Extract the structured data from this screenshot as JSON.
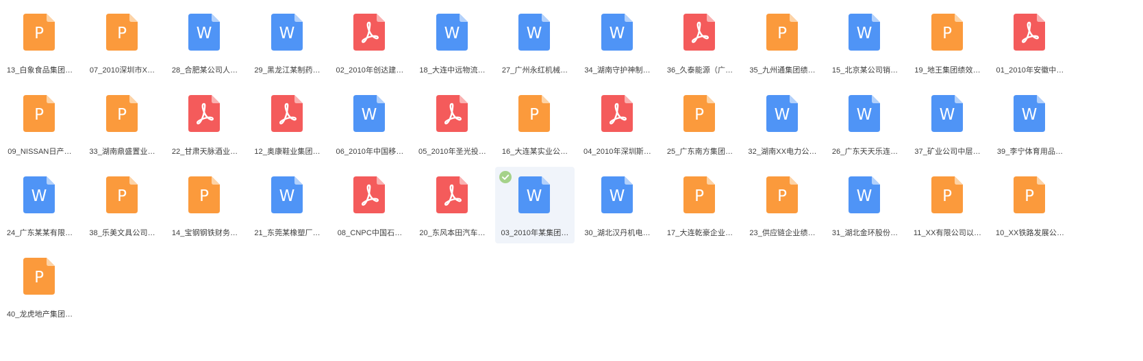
{
  "colors": {
    "ppt": "#fb9a3c",
    "ppt_fold": "#fdd3a6",
    "word": "#4f94f6",
    "word_fold": "#b3d1fb",
    "pdf": "#f45b5b",
    "pdf_fold": "#fab1b1",
    "selected_bg": "#f0f4fa",
    "check": "#a5d28a"
  },
  "files": [
    {
      "type": "ppt",
      "name": "13_白象食品集团…"
    },
    {
      "type": "ppt",
      "name": "07_2010深圳市X…"
    },
    {
      "type": "word",
      "name": "28_合肥某公司人…"
    },
    {
      "type": "word",
      "name": "29_黑龙江某制药…"
    },
    {
      "type": "pdf",
      "name": "02_2010年创达建…"
    },
    {
      "type": "word",
      "name": "18_大连中远物流…"
    },
    {
      "type": "word",
      "name": "27_广州永红机械…"
    },
    {
      "type": "word",
      "name": "34_湖南守护神制…"
    },
    {
      "type": "pdf",
      "name": "36_久泰能源（广…"
    },
    {
      "type": "ppt",
      "name": "35_九州通集团绩…"
    },
    {
      "type": "word",
      "name": "15_北京某公司销…"
    },
    {
      "type": "ppt",
      "name": "19_地王集团绩效…"
    },
    {
      "type": "pdf",
      "name": "01_2010年安徽中…"
    },
    {
      "type": "ppt",
      "name": "09_NISSAN日产…"
    },
    {
      "type": "ppt",
      "name": "33_湖南鼎盛置业…"
    },
    {
      "type": "pdf",
      "name": "22_甘肃天脉酒业…"
    },
    {
      "type": "pdf",
      "name": "12_奥康鞋业集团…"
    },
    {
      "type": "word",
      "name": "06_2010年中国移…"
    },
    {
      "type": "pdf",
      "name": "05_2010年圣光投…"
    },
    {
      "type": "ppt",
      "name": "16_大连某实业公…"
    },
    {
      "type": "pdf",
      "name": "04_2010年深圳斯…"
    },
    {
      "type": "ppt",
      "name": "25_广东南方集团…"
    },
    {
      "type": "word",
      "name": "32_湖南XX电力公…"
    },
    {
      "type": "word",
      "name": "26_广东天天乐连…"
    },
    {
      "type": "word",
      "name": "37_矿业公司中层…"
    },
    {
      "type": "word",
      "name": "39_李宁体育用品…"
    },
    {
      "type": "word",
      "name": "24_广东某某有限…"
    },
    {
      "type": "ppt",
      "name": "38_乐美文具公司…"
    },
    {
      "type": "ppt",
      "name": "14_宝钢钢铁财务…"
    },
    {
      "type": "word",
      "name": "21_东莞某橡塑厂…"
    },
    {
      "type": "pdf",
      "name": "08_CNPC中国石…"
    },
    {
      "type": "pdf",
      "name": "20_东风本田汽车…"
    },
    {
      "type": "word",
      "name": "03_2010年某集团…",
      "selected": true
    },
    {
      "type": "word",
      "name": "30_湖北汉丹机电…"
    },
    {
      "type": "ppt",
      "name": "17_大连乾豪企业…"
    },
    {
      "type": "ppt",
      "name": "23_供应链企业绩…"
    },
    {
      "type": "word",
      "name": "31_湖北金环股份…"
    },
    {
      "type": "ppt",
      "name": "11_XX有限公司以…"
    },
    {
      "type": "ppt",
      "name": "10_XX铁路发展公…"
    },
    {
      "type": "ppt",
      "name": "40_龙虎地产集团…"
    }
  ],
  "icons": {
    "ppt": {
      "glyph": "P",
      "name": "powerpoint-file-icon"
    },
    "word": {
      "glyph": "W",
      "name": "word-file-icon"
    },
    "pdf": {
      "glyph": "",
      "name": "pdf-file-icon"
    },
    "check": {
      "name": "check-circle-icon"
    }
  }
}
